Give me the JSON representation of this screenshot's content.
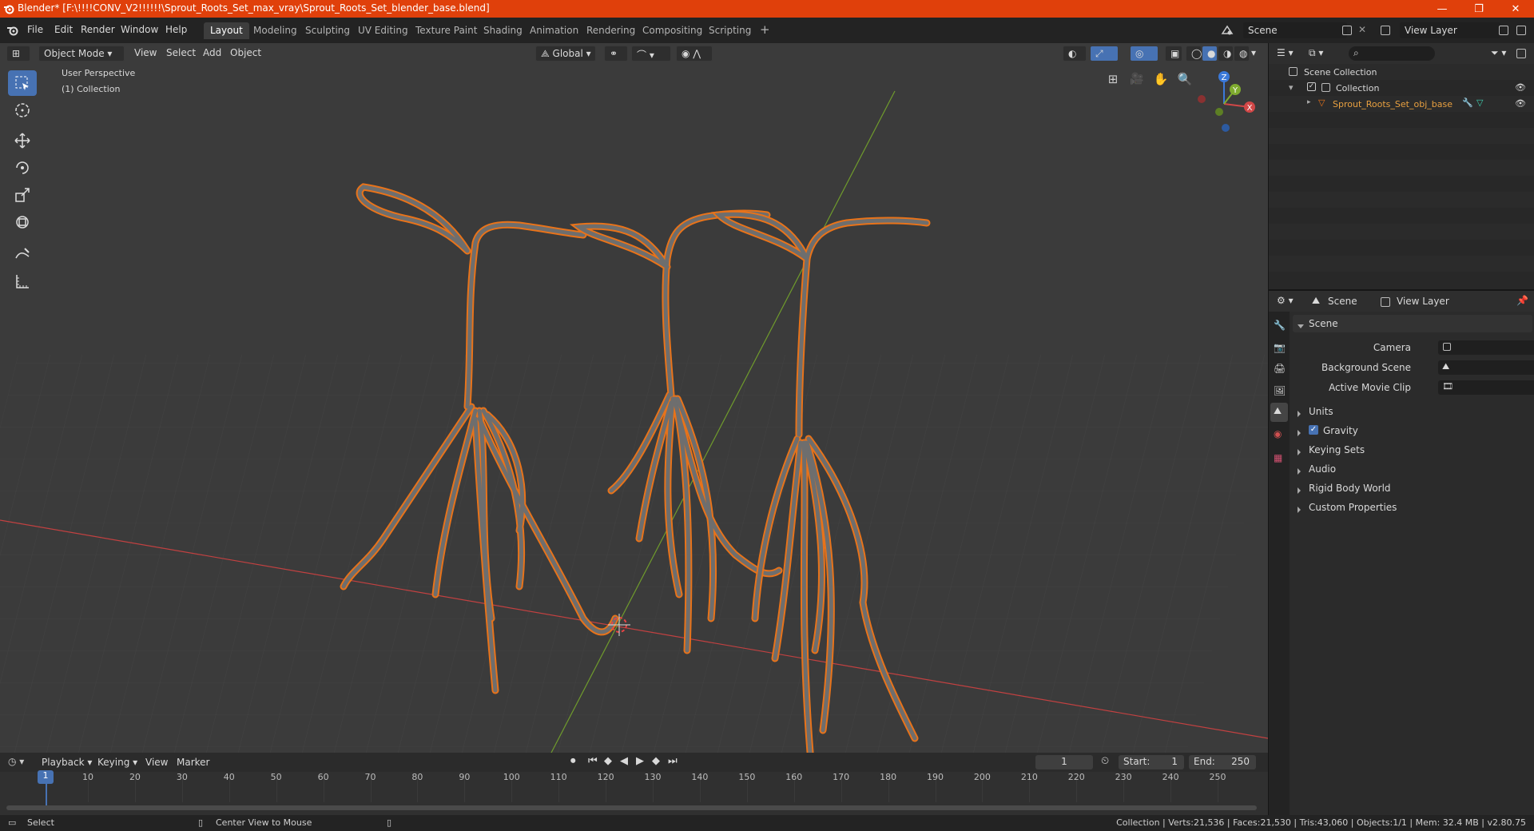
{
  "titlebar": {
    "title": "Blender* [F:\\!!!!CONV_V2!!!!!!\\Sprout_Roots_Set_max_vray\\Sprout_Roots_Set_blender_base.blend]",
    "minimize": "—",
    "maximize": "❐",
    "close": "✕",
    "bg_color": "#e0400b"
  },
  "menubar": {
    "menus": [
      "File",
      "Edit",
      "Render",
      "Window",
      "Help"
    ],
    "workspaces": [
      "Layout",
      "Modeling",
      "Sculpting",
      "UV Editing",
      "Texture Paint",
      "Shading",
      "Animation",
      "Rendering",
      "Compositing",
      "Scripting"
    ],
    "active_workspace": "Layout",
    "add_workspace": "+",
    "scene_name": "Scene",
    "view_layer_name": "View Layer"
  },
  "viewport_header": {
    "mode": "Object Mode",
    "menus": [
      "View",
      "Select",
      "Add",
      "Object"
    ],
    "orientation": "Global"
  },
  "viewport": {
    "overlay_title": "User Perspective",
    "overlay_subtitle": "(1) Collection",
    "gizmo_labels": {
      "x": "X",
      "y": "Y",
      "z": "Z"
    },
    "selection_color": "#e8731a",
    "mesh_color": "#6e6e6e"
  },
  "outliner": {
    "search_placeholder": "",
    "root": "Scene Collection",
    "collection": "Collection",
    "object": "Sprout_Roots_Set_obj_base"
  },
  "properties": {
    "tab_scene": "Scene",
    "tab_view_layer": "View Layer",
    "section_title": "Scene",
    "fields": [
      {
        "label": "Camera"
      },
      {
        "label": "Background Scene"
      },
      {
        "label": "Active Movie Clip"
      }
    ],
    "panels": [
      "Units",
      "Gravity",
      "Keying Sets",
      "Audio",
      "Rigid Body World",
      "Custom Properties"
    ],
    "gravity_checked": true
  },
  "timeline": {
    "menus": [
      "Playback",
      "Keying",
      "View",
      "Marker"
    ],
    "current_frame": "1",
    "start_label": "Start:",
    "start": "1",
    "end_label": "End:",
    "end": "250",
    "frame_numbers": [
      "1",
      "10",
      "20",
      "30",
      "40",
      "50",
      "60",
      "70",
      "80",
      "90",
      "100",
      "110",
      "120",
      "130",
      "140",
      "150",
      "160",
      "170",
      "180",
      "190",
      "200",
      "210",
      "220",
      "230",
      "240",
      "250"
    ]
  },
  "statusbar": {
    "select": "Select",
    "center_view": "Center View to Mouse",
    "stats": "Collection | Verts:21,536 | Faces:21,530 | Tris:43,060 | Objects:1/1 | Mem: 32.4 MB | v2.80.75"
  }
}
